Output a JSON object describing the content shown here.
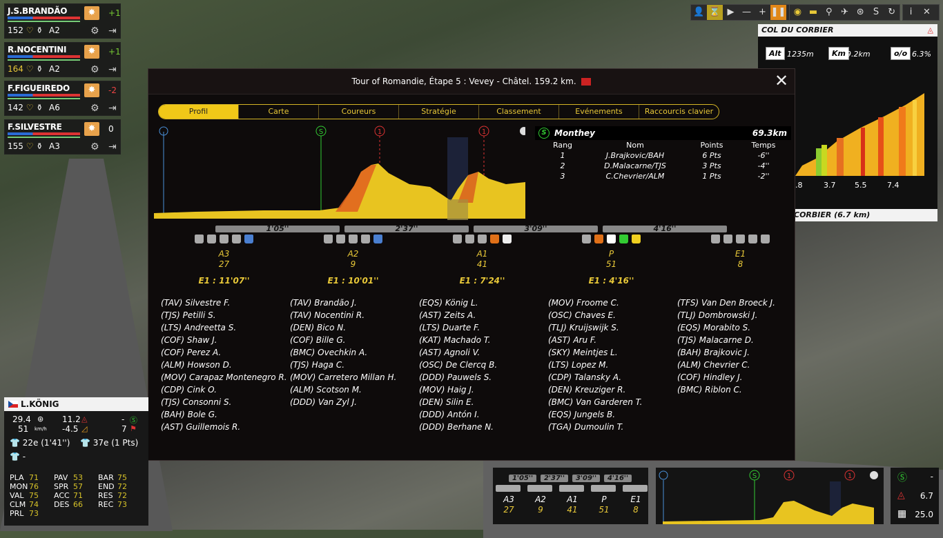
{
  "riders": [
    {
      "name": "J.S.BRANDÃO",
      "energy": "152",
      "alt": "A2",
      "delta": "+1",
      "delta_color": "#7c3"
    },
    {
      "name": "R.NOCENTINI",
      "energy": "164",
      "alt": "A2",
      "delta": "+1",
      "delta_color": "#7c3"
    },
    {
      "name": "F.FIGUEIREDO",
      "energy": "142",
      "alt": "A6",
      "delta": "-2",
      "delta_color": "#e44"
    },
    {
      "name": "F.SILVESTRE",
      "energy": "155",
      "alt": "A3",
      "delta": "0",
      "delta_color": "#fff"
    }
  ],
  "toolbar": {
    "icons": [
      "person-icon",
      "hourglass-icon",
      "play-icon",
      "minus-icon",
      "plus-icon",
      "pause-icon",
      "eye-icon",
      "car-icon",
      "moto-icon",
      "helicopter-icon",
      "wheel-icon",
      "sprint-icon",
      "refresh-icon",
      "info-icon",
      "close-icon"
    ]
  },
  "col": {
    "title": "COL DU CORBIER",
    "alt_label": "Alt",
    "alt": "1235m",
    "km_label": "Km",
    "km": "9.2km",
    "pct_label": "o/o",
    "pct": "6.3%",
    "ticks": [
      ".8",
      "3.7",
      "5.5",
      "7.4"
    ],
    "footer": "CORBIER (6.7 km)"
  },
  "modal": {
    "title": "Tour of Romandie, Étape 5 : Vevey - Châtel. 159.2 km.",
    "tabs": [
      "Profil",
      "Carte",
      "Coureurs",
      "Stratégie",
      "Classement",
      "Evénements",
      "Raccourcis clavier"
    ],
    "sprint": {
      "badge": "S",
      "place": "Monthey",
      "km": "69.3km",
      "headers": [
        "Rang",
        "Nom",
        "Points",
        "Temps"
      ],
      "rows": [
        [
          "1",
          "J.Brajkovic/BAH",
          "6 Pts",
          "-6''"
        ],
        [
          "2",
          "D.Malacarne/TJS",
          "3 Pts",
          "-4''"
        ],
        [
          "3",
          "C.Chevrier/ALM",
          "1 Pts",
          "-2''"
        ]
      ]
    },
    "gaps": [
      "1'05''",
      "2'37''",
      "3'09''",
      "4'16''"
    ],
    "groups": [
      {
        "name": "A3",
        "count": "27",
        "time": "E1 : 11'07''",
        "riders": [
          "(TAV) Silvestre F.",
          "(TJS) Petilli S.",
          "(LTS) Andreetta S.",
          "(COF) Shaw J.",
          "(COF) Perez A.",
          "(ALM) Howson D.",
          "(MOV) Carapaz Montenegro R.",
          "(CDP) Cink O.",
          "(TJS) Consonni S.",
          "(BAH) Bole G.",
          "(AST) Guillemois R."
        ]
      },
      {
        "name": "A2",
        "count": "9",
        "time": "E1 : 10'01''",
        "riders": [
          "(TAV) Brandão J.",
          "(TAV) Nocentini R.",
          "(DEN) Bico N.",
          "(COF) Bille G.",
          "(BMC) Ovechkin A.",
          "(TJS) Haga C.",
          "(MOV) Carretero Millan H.",
          "(ALM) Scotson M.",
          "(DDD) Van Zyl J."
        ]
      },
      {
        "name": "A1",
        "count": "41",
        "time": "E1 : 7'24''",
        "riders": [
          "(EQS) König L.",
          "(AST) Zeits A.",
          "(LTS) Duarte F.",
          "(KAT) Machado T.",
          "(AST) Agnoli V.",
          "(OSC) De Clercq B.",
          "(DDD) Pauwels S.",
          "(MOV) Haig J.",
          "(DEN) Silin E.",
          "(DDD) Antón I.",
          "(DDD) Berhane N."
        ]
      },
      {
        "name": "P",
        "count": "51",
        "time": "E1 : 4'16''",
        "riders": [
          "(MOV) Froome C.",
          "(OSC) Chaves E.",
          "(TLJ) Kruijswijk S.",
          "(AST) Aru F.",
          "(SKY) Meintjes L.",
          "(LTS) Lopez M.",
          "(CDP) Talansky A.",
          "(DEN) Kreuziger R.",
          "(BMC) Van Garderen T.",
          "(EQS) Jungels B.",
          "(TGA) Dumoulin T."
        ]
      },
      {
        "name": "E1",
        "count": "8",
        "time": "",
        "riders": [
          "(TFS) Van Den Broeck J.",
          "(TLJ) Dombrowski J.",
          "(EQS) Morabito S.",
          "(TJS) Malacarne D.",
          "(BAH) Brajkovic J.",
          "(ALM) Chevrier C.",
          "(COF) Hindley J.",
          "(BMC) Riblon C."
        ]
      }
    ],
    "profile_marks": [
      "S",
      "1",
      "1"
    ]
  },
  "leader": {
    "name": "L.KÖNIG",
    "speed1": "29.4",
    "speed2": "51",
    "unit": "km/h",
    "v1": "11.2",
    "v2": "-4.5",
    "v3": "-",
    "v4": "7",
    "yellow": "22e (1'41'')",
    "green": "37e (1 Pts)",
    "white": "-",
    "stats": [
      [
        "PLA",
        "71",
        "PAV",
        "53",
        "BAR",
        "75"
      ],
      [
        "MON",
        "76",
        "SPR",
        "57",
        "END",
        "72"
      ],
      [
        "VAL",
        "75",
        "ACC",
        "71",
        "RES",
        "72"
      ],
      [
        "CLM",
        "74",
        "DES",
        "66",
        "REC",
        "73"
      ],
      [
        "PRL",
        "73",
        "",
        "",
        "",
        ""
      ]
    ]
  },
  "mini": {
    "gaps": [
      "1'05''",
      "2'37''",
      "3'09''",
      "4'16''"
    ],
    "groups": [
      [
        "A3",
        "27"
      ],
      [
        "A2",
        "9"
      ],
      [
        "A1",
        "41"
      ],
      [
        "P",
        "51"
      ],
      [
        "E1",
        "8"
      ]
    ],
    "right": [
      "-",
      "6.7",
      "25.0"
    ]
  }
}
